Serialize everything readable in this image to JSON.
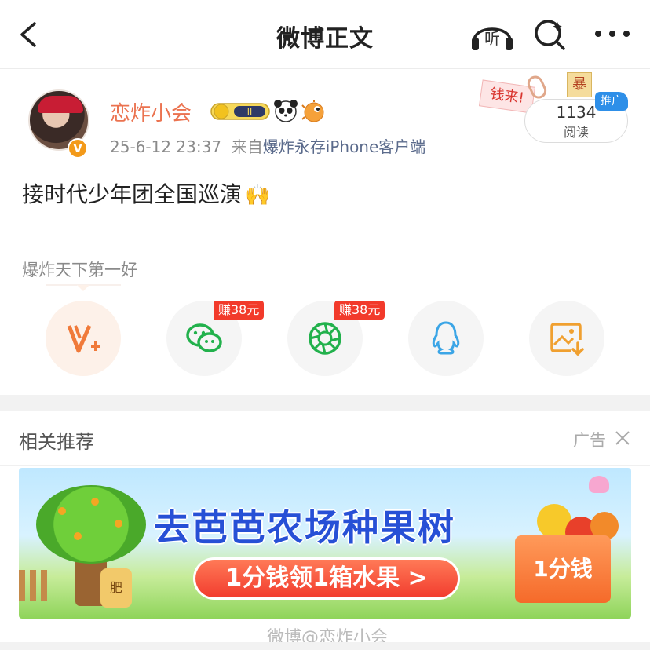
{
  "nav": {
    "title": "微博正文",
    "listen_label": "听"
  },
  "post": {
    "username": "恋炸小会",
    "timestamp": "25-6-12 23:37",
    "from_prefix": "来自",
    "source": "爆炸永存iPhone客户端",
    "read_count": "1134",
    "read_label": "阅读",
    "promo_tag": "推广",
    "sticker_money": "钱来!",
    "sticker_bao": "暴",
    "verified_badge": "V",
    "content": "接时代少年团全国巡演",
    "content_emoji": "🙌",
    "topic": "爆炸天下第一好"
  },
  "share": {
    "earn_wechat": "赚38元",
    "earn_moments": "赚38元",
    "icons": [
      "v-plus-icon",
      "wechat-icon",
      "moments-icon",
      "qq-icon",
      "save-image-icon"
    ]
  },
  "related": {
    "title": "相关推荐",
    "ad_label": "广告"
  },
  "banner": {
    "headline": "去芭芭农场种果树",
    "cta": "1分钱领1箱水果 >",
    "box_text": "1分钱",
    "bag_text": "肥"
  },
  "watermark": "微博@恋炸小会",
  "colors": {
    "username": "#eb7350",
    "link": "#5b6b8c",
    "earn_badge": "#f23a2b",
    "promo_tag": "#2e8fe8",
    "banner_headline": "#2750d6"
  }
}
